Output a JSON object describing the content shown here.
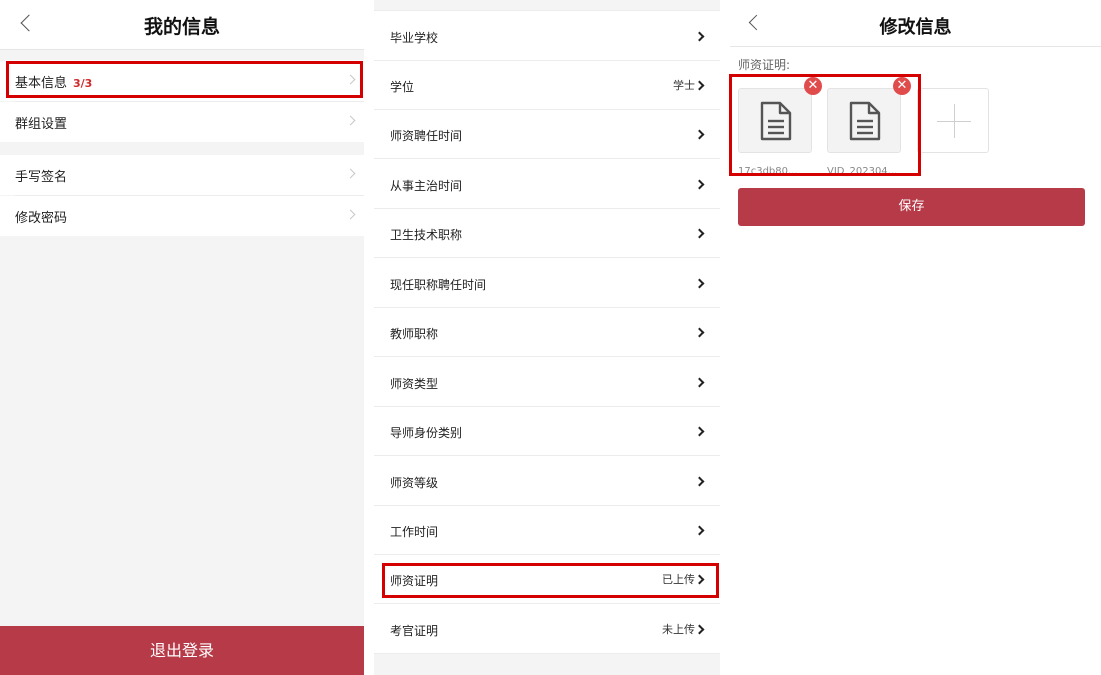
{
  "panel1": {
    "title": "我的信息",
    "rows": [
      {
        "label": "基本信息",
        "count": "3/3"
      },
      {
        "label": "群组设置"
      },
      {
        "label": "手写签名"
      },
      {
        "label": "修改密码"
      }
    ],
    "logout": "退出登录"
  },
  "panel2": {
    "rows": [
      {
        "label": "毕业学校",
        "value": ""
      },
      {
        "label": "学位",
        "value": "学士"
      },
      {
        "label": "师资聘任时间",
        "value": ""
      },
      {
        "label": "从事主治时间",
        "value": ""
      },
      {
        "label": "卫生技术职称",
        "value": ""
      },
      {
        "label": "现任职称聘任时间",
        "value": ""
      },
      {
        "label": "教师职称",
        "value": ""
      },
      {
        "label": "师资类型",
        "value": ""
      },
      {
        "label": "导师身份类别",
        "value": ""
      },
      {
        "label": "师资等级",
        "value": ""
      },
      {
        "label": "工作时间",
        "value": ""
      },
      {
        "label": "师资证明",
        "value": "已上传"
      },
      {
        "label": "考官证明",
        "value": "未上传"
      }
    ]
  },
  "panel3": {
    "title": "修改信息",
    "field_label": "师资证明:",
    "files": [
      {
        "name": "17c3db80..."
      },
      {
        "name": "VID_202304..."
      }
    ],
    "save": "保存"
  },
  "colors": {
    "accent": "#b63a47",
    "highlight": "#d40000",
    "delete_badge": "#e04c4c",
    "count_red": "#d12a2a"
  },
  "icons": {
    "back": "chevron-left-icon",
    "row_arrow": "chevron-right-icon",
    "file": "document-icon",
    "delete": "close-circle-icon",
    "add": "plus-icon"
  }
}
